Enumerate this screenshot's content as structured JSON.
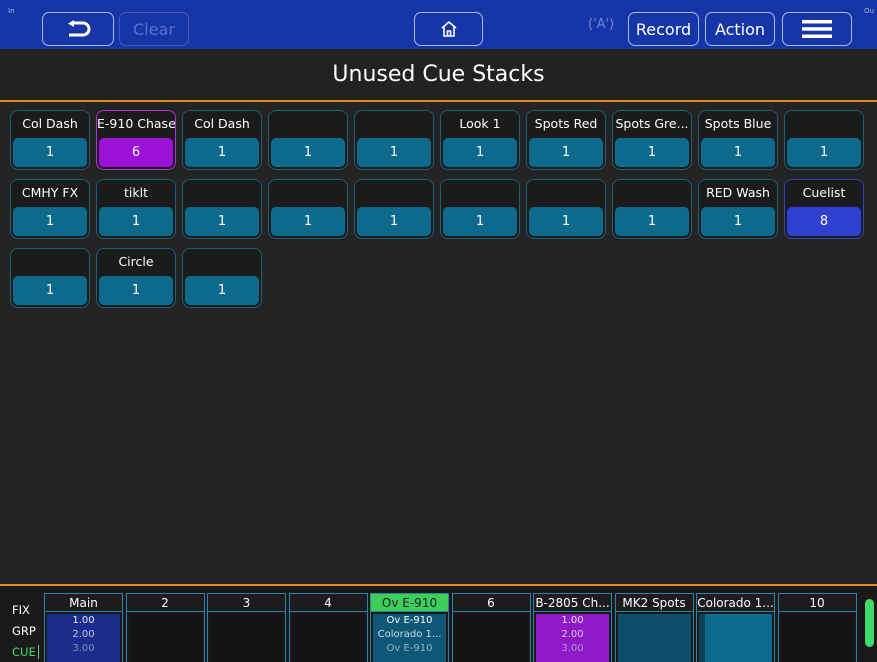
{
  "topbar": {
    "in_label": "In",
    "out_label": "Ou",
    "clear_label": "Clear",
    "record_label": "Record",
    "action_label": "Action",
    "antenna_glyph": "('A')",
    "accent": "#1636a8"
  },
  "page": {
    "title": "Unused Cue Stacks"
  },
  "cues": [
    {
      "name": "Col Dash",
      "value": "1",
      "style": "normal"
    },
    {
      "name": "E-910 Chase",
      "value": "6",
      "style": "purple"
    },
    {
      "name": "Col Dash",
      "value": "1",
      "style": "normal"
    },
    {
      "name": "",
      "value": "1",
      "style": "normal"
    },
    {
      "name": "",
      "value": "1",
      "style": "normal"
    },
    {
      "name": "Look 1",
      "value": "1",
      "style": "normal"
    },
    {
      "name": "Spots Red",
      "value": "1",
      "style": "normal"
    },
    {
      "name": "Spots Gre...",
      "value": "1",
      "style": "normal"
    },
    {
      "name": "Spots Blue",
      "value": "1",
      "style": "normal"
    },
    {
      "name": "",
      "value": "1",
      "style": "normal"
    },
    {
      "name": "CMHY FX",
      "value": "1",
      "style": "normal"
    },
    {
      "name": "tiklt",
      "value": "1",
      "style": "normal"
    },
    {
      "name": "",
      "value": "1",
      "style": "normal"
    },
    {
      "name": "",
      "value": "1",
      "style": "normal"
    },
    {
      "name": "",
      "value": "1",
      "style": "normal"
    },
    {
      "name": "",
      "value": "1",
      "style": "normal"
    },
    {
      "name": "",
      "value": "1",
      "style": "normal"
    },
    {
      "name": "",
      "value": "1",
      "style": "normal"
    },
    {
      "name": "RED Wash",
      "value": "1",
      "style": "normal"
    },
    {
      "name": "Cuelist",
      "value": "8",
      "style": "blue"
    },
    {
      "name": "",
      "value": "1",
      "style": "normal"
    },
    {
      "name": "Circle",
      "value": "1",
      "style": "normal"
    },
    {
      "name": "",
      "value": "1",
      "style": "normal"
    }
  ],
  "modes": {
    "fix": "FIX",
    "grp": "GRP",
    "cue": "CUE"
  },
  "faders": [
    {
      "name": "Main",
      "lines": [
        "1.00",
        "2.00",
        "3.00"
      ],
      "style": "main"
    },
    {
      "name": "2",
      "lines": [
        "",
        "",
        ""
      ],
      "style": "empty"
    },
    {
      "name": "3",
      "lines": [
        "",
        "",
        ""
      ],
      "style": "empty"
    },
    {
      "name": "4",
      "lines": [
        "",
        "",
        ""
      ],
      "style": "empty"
    },
    {
      "name": "Ov E-910",
      "lines": [
        "Ov E-910",
        "Colorado 1...",
        "Ov E-910"
      ],
      "style": "ov"
    },
    {
      "name": "6",
      "lines": [
        "",
        "",
        ""
      ],
      "style": "empty"
    },
    {
      "name": "B-2805 Ch...",
      "lines": [
        "1.00",
        "2.00",
        "3.00"
      ],
      "style": "b28"
    },
    {
      "name": "MK2 Spots",
      "lines": [
        "",
        "",
        ""
      ],
      "style": "mk2"
    },
    {
      "name": "Colorado 1...",
      "lines": [
        "",
        "",
        ""
      ],
      "style": "colo"
    },
    {
      "name": "10",
      "lines": [
        "",
        "",
        ""
      ],
      "style": "empty"
    }
  ]
}
